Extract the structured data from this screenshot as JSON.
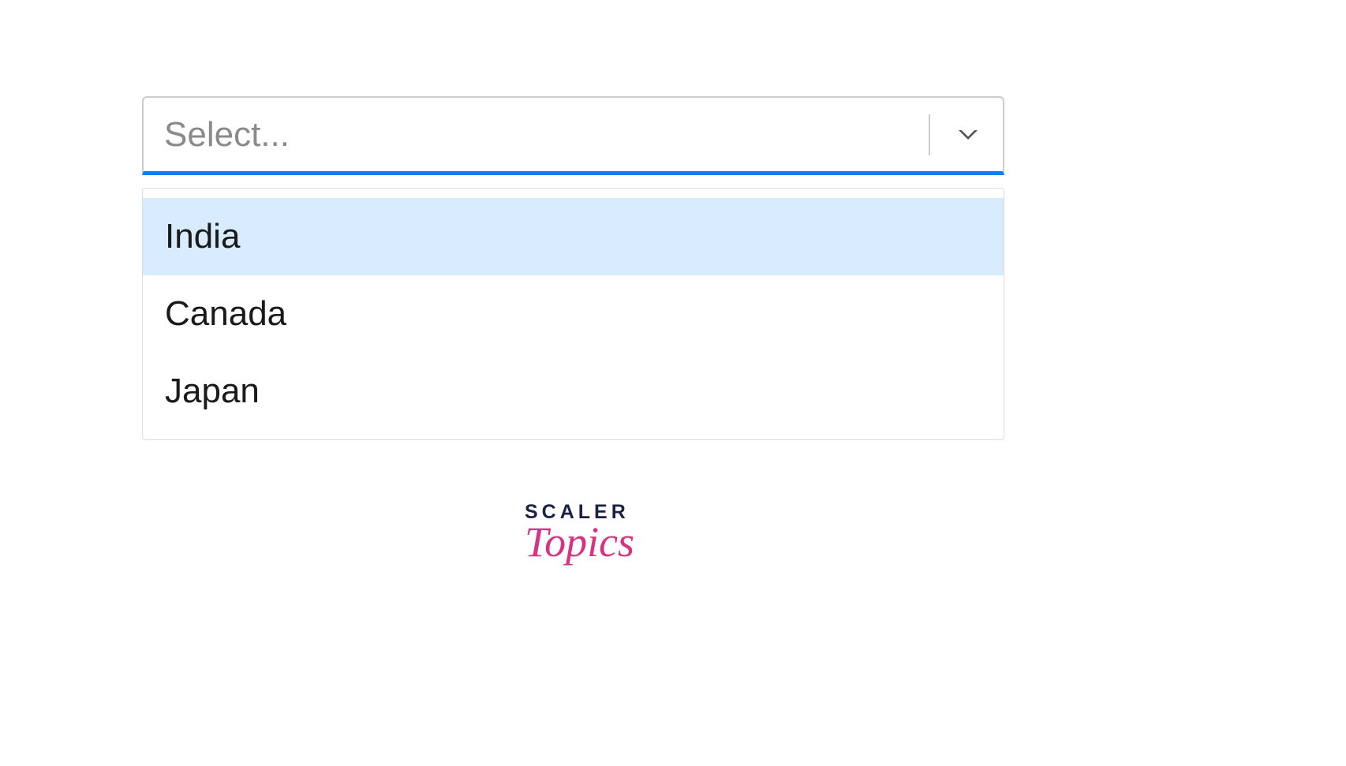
{
  "select": {
    "placeholder": "Select...",
    "options": [
      {
        "label": "India",
        "highlighted": true
      },
      {
        "label": "Canada",
        "highlighted": false
      },
      {
        "label": "Japan",
        "highlighted": false
      }
    ]
  },
  "logo": {
    "line1": "SCALER",
    "line2": "Topics"
  }
}
